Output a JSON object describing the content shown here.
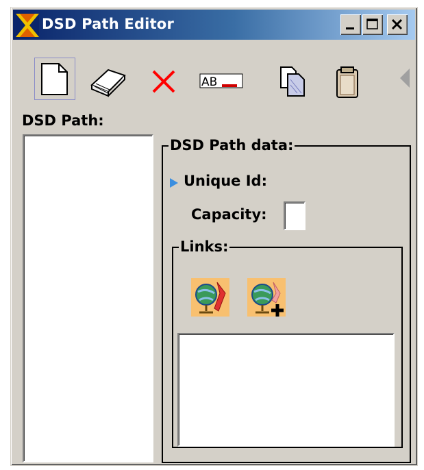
{
  "window": {
    "title": "DSD Path Editor",
    "controls": {
      "minimize": "minimize-icon",
      "maximize": "maximize-icon",
      "close": "close-icon"
    }
  },
  "toolbar": {
    "buttons": [
      {
        "icon": "new-document-icon",
        "active": true
      },
      {
        "icon": "eraser-icon"
      },
      {
        "icon": "delete-x-icon",
        "color": "#ff0000"
      },
      {
        "icon": "rename-icon",
        "text": "AB"
      },
      {
        "icon": "copy-icon"
      },
      {
        "icon": "paste-clipboard-icon"
      },
      {
        "icon": "scroll-left-arrow-icon"
      }
    ]
  },
  "left_panel": {
    "label": "DSD Path:"
  },
  "path_data": {
    "legend": "DSD Path data:",
    "unique_id_label": "Unique Id:",
    "capacity_label": "Capacity:",
    "capacity_value": "",
    "links": {
      "legend": "Links:",
      "buttons": [
        {
          "icon": "globe-link-icon"
        },
        {
          "icon": "globe-add-link-icon"
        }
      ]
    }
  }
}
